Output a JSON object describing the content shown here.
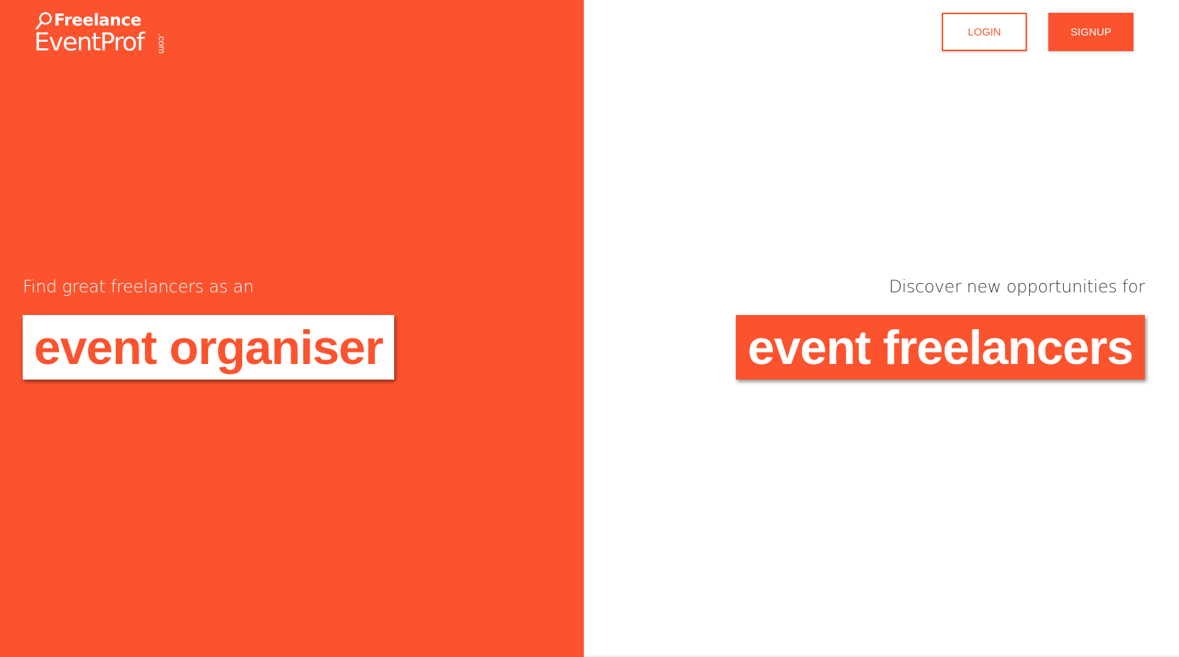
{
  "colors": {
    "brand": "#FC532F",
    "background_right": "#FFFFFF",
    "subtitle_right": "#3A3A3A"
  },
  "logo": {
    "line1": "Freelance",
    "line2": "EventProf",
    "tld": ".com",
    "icon": "search-icon"
  },
  "header": {
    "login_label": "LOGIN",
    "signup_label": "SIGNUP"
  },
  "left": {
    "subtitle": "Find great freelancers as an",
    "hero": "event organiser"
  },
  "right": {
    "subtitle": "Discover new opportunities for",
    "hero": "event freelancers"
  }
}
